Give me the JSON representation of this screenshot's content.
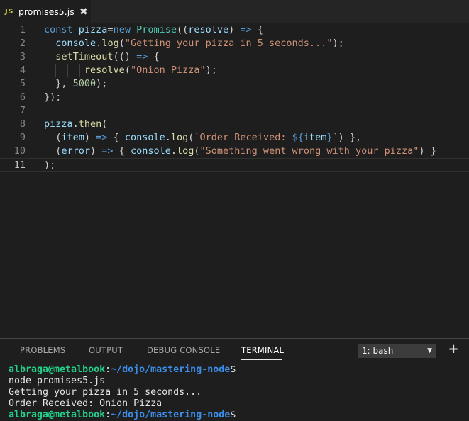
{
  "tab": {
    "lang_badge": "JS",
    "filename": "promises5.js",
    "close_glyph": "✖"
  },
  "editor": {
    "lines": [
      {
        "num": "1",
        "tokens": [
          [
            "kw",
            "const "
          ],
          [
            "var",
            "pizza"
          ],
          [
            "",
            "="
          ],
          [
            "kw",
            "new "
          ],
          [
            "cls",
            "Promise"
          ],
          [
            "",
            "(("
          ],
          [
            "var",
            "resolve"
          ],
          [
            "",
            ") "
          ],
          [
            "kw",
            "=>"
          ],
          [
            "",
            " {"
          ]
        ]
      },
      {
        "num": "2",
        "tokens": [
          [
            "",
            "  "
          ],
          [
            "var",
            "console"
          ],
          [
            "",
            "."
          ],
          [
            "fn",
            "log"
          ],
          [
            "",
            "("
          ],
          [
            "str",
            "\"Getting your pizza in 5 seconds...\""
          ],
          [
            "",
            ");"
          ]
        ]
      },
      {
        "num": "3",
        "tokens": [
          [
            "",
            "  "
          ],
          [
            "fn",
            "setTimeout"
          ],
          [
            "",
            "(() "
          ],
          [
            "kw",
            "=>"
          ],
          [
            "",
            " {"
          ]
        ]
      },
      {
        "num": "4",
        "tokens": [
          [
            "",
            "       "
          ],
          [
            "fn",
            "resolve"
          ],
          [
            "",
            "("
          ],
          [
            "str",
            "\"Onion Pizza\""
          ],
          [
            "",
            ");"
          ]
        ]
      },
      {
        "num": "5",
        "tokens": [
          [
            "",
            "  }, "
          ],
          [
            "num",
            "5000"
          ],
          [
            "",
            ");"
          ]
        ]
      },
      {
        "num": "6",
        "tokens": [
          [
            "",
            "});"
          ]
        ]
      },
      {
        "num": "7",
        "tokens": []
      },
      {
        "num": "8",
        "tokens": [
          [
            "var",
            "pizza"
          ],
          [
            "",
            "."
          ],
          [
            "fn",
            "then"
          ],
          [
            "",
            "("
          ]
        ]
      },
      {
        "num": "9",
        "tokens": [
          [
            "",
            "  ("
          ],
          [
            "var",
            "item"
          ],
          [
            "",
            ") "
          ],
          [
            "kw",
            "=>"
          ],
          [
            "",
            " { "
          ],
          [
            "var",
            "console"
          ],
          [
            "",
            "."
          ],
          [
            "fn",
            "log"
          ],
          [
            "",
            "("
          ],
          [
            "str",
            "`Order Received: "
          ],
          [
            "tpl",
            "${"
          ],
          [
            "var",
            "item"
          ],
          [
            "tpl",
            "}"
          ],
          [
            "str",
            "`"
          ],
          [
            "",
            ") },"
          ]
        ]
      },
      {
        "num": "10",
        "tokens": [
          [
            "",
            "  ("
          ],
          [
            "var",
            "error"
          ],
          [
            "",
            ") "
          ],
          [
            "kw",
            "=>"
          ],
          [
            "",
            " { "
          ],
          [
            "var",
            "console"
          ],
          [
            "",
            "."
          ],
          [
            "fn",
            "log"
          ],
          [
            "",
            "("
          ],
          [
            "str",
            "\"Something went wrong with your pizza\""
          ],
          [
            "",
            ") }"
          ]
        ]
      },
      {
        "num": "11",
        "tokens": [
          [
            "",
            ");"
          ]
        ]
      }
    ],
    "active_line": 11
  },
  "panel": {
    "tabs": [
      "PROBLEMS",
      "OUTPUT",
      "DEBUG CONSOLE",
      "TERMINAL"
    ],
    "active_tab": "TERMINAL",
    "terminal_select": "1: bash",
    "select_caret": "▼",
    "add_glyph": "+"
  },
  "terminal": {
    "prompt_user": "albraga@metalbook",
    "prompt_path": "~/dojo/mastering-node",
    "prompt_symbol": "$",
    "command": "node promises5.js",
    "output": [
      "Getting your pizza in 5 seconds...",
      "Order Received: Onion Pizza"
    ],
    "next_prompt_user": "albraga@metalbook",
    "next_prompt_path": "~/dojo/mastering-node",
    "next_prompt_symbol": "$"
  },
  "colors": {
    "editor_bg": "#1e1e1e",
    "tabbar_bg": "#252526",
    "keyword": "#569cd6",
    "string": "#ce9178",
    "function": "#dcdcaa",
    "class": "#4ec9b0",
    "variable": "#9cdcfe",
    "number": "#b5cea8",
    "prompt_user": "#23d18b",
    "prompt_path": "#3b8eea"
  }
}
